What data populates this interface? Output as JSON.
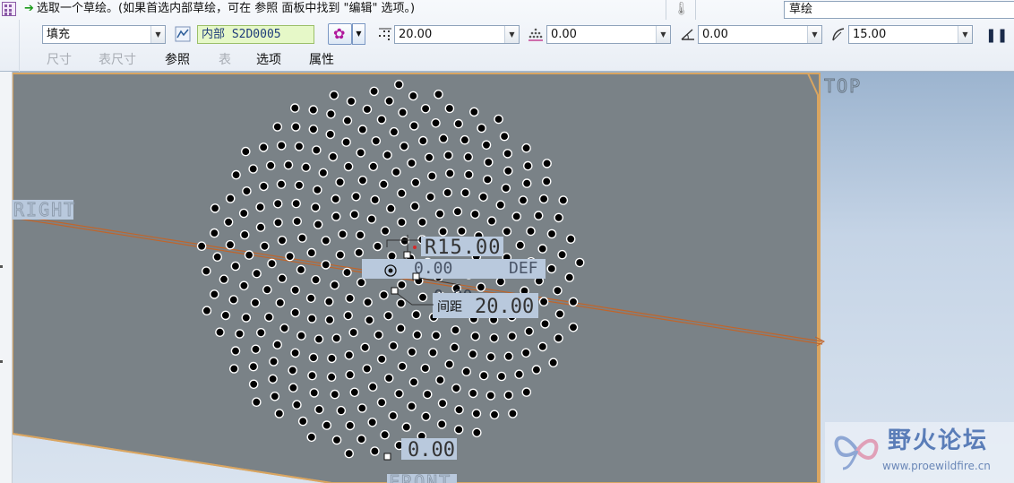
{
  "message": {
    "text": "选取一个草绘。(如果首选内部草绘，可在 参照 面板中找到 \"编辑\" 选项。)"
  },
  "filter": {
    "value": "草绘"
  },
  "toolbar": {
    "fill_type": "填充",
    "sketch_name": "内部 S2D0005",
    "spacing": "20.00",
    "min_distance": "0.00",
    "angle": "0.00",
    "radius": "15.00"
  },
  "tabs": [
    {
      "label": "尺寸",
      "enabled": false
    },
    {
      "label": "表尺寸",
      "enabled": false
    },
    {
      "label": "参照",
      "enabled": true
    },
    {
      "label": "表",
      "enabled": false
    },
    {
      "label": "选项",
      "enabled": true
    },
    {
      "label": "属性",
      "enabled": true
    }
  ],
  "viewport": {
    "datum_top": "TOP",
    "datum_right": "RIGHT",
    "datum_front": "FRONT",
    "dim_radius": "R15.00",
    "dim_angle": "0.00",
    "dim_angle_unit": "DEF",
    "dim_minor": "0.00",
    "dim_spacing_label": "间距",
    "dim_spacing_value": "20.00",
    "dim_bottom": "0.00",
    "colors": {
      "plane": "#7a8287",
      "plane_edge": "#d9a561",
      "axis": "#c0652b",
      "dot": "#000000",
      "dim_box": "#b9c9dd"
    }
  },
  "watermark": {
    "title": "野火论坛",
    "url": "www.proewildfire.cn"
  },
  "icons": {
    "app": "pattern-feature-icon",
    "message": "green-arrow-icon",
    "thermometer": "thermometer-icon",
    "sketch": "sketch-icon",
    "pattern": "fill-pattern-icon",
    "spacing": "spacing-icon",
    "min_distance": "min-distance-icon",
    "angle": "angle-icon",
    "radius": "radius-icon",
    "pause": "pause-icon"
  }
}
